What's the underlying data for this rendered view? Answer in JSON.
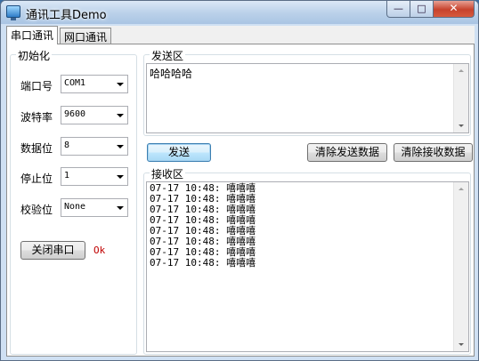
{
  "window": {
    "title": "通讯工具Demo",
    "controls": {
      "minimize": "—",
      "maximize": "□",
      "close": "✕"
    }
  },
  "tabs": [
    {
      "label": "串口通讯",
      "active": true
    },
    {
      "label": "网口通讯",
      "active": false
    }
  ],
  "init_group": {
    "title": "初始化",
    "fields": [
      {
        "label": "端口号",
        "value": "COM1"
      },
      {
        "label": "波特率",
        "value": "9600"
      },
      {
        "label": "数据位",
        "value": "8"
      },
      {
        "label": "停止位",
        "value": "1"
      },
      {
        "label": "校验位",
        "value": "None"
      }
    ],
    "close_port_label": "关闭串口",
    "status": "Ok"
  },
  "send_group": {
    "title": "发送区",
    "text": "哈哈哈哈"
  },
  "actions": {
    "send": "发送",
    "clear_send": "清除发送数据",
    "clear_receive": "清除接收数据"
  },
  "receive_group": {
    "title": "接收区",
    "lines": [
      "07-17 10:48: 嘻嘻嘻",
      "07-17 10:48: 嘻嘻嘻",
      "07-17 10:48: 嘻嘻嘻",
      "07-17 10:48: 嘻嘻嘻",
      "07-17 10:48: 嘻嘻嘻",
      "07-17 10:48: 嘻嘻嘻",
      "07-17 10:48: 嘻嘻嘻",
      "07-17 10:48: 嘻嘻嘻"
    ]
  }
}
